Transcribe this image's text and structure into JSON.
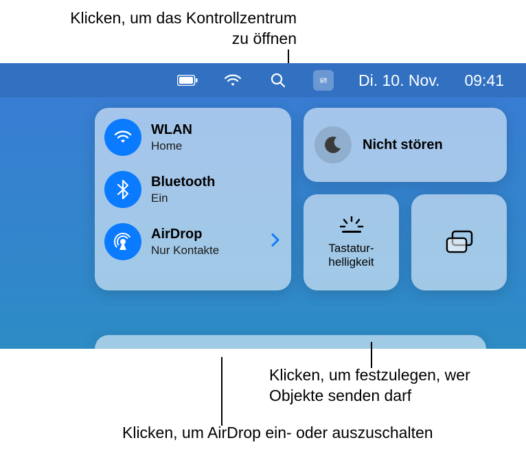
{
  "callouts": {
    "top": "Klicken, um das Kontrollzentrum zu öffnen",
    "right": "Klicken, um festzulegen, wer Objekte senden darf",
    "bottom": "Klicken, um AirDrop ein- oder auszuschalten"
  },
  "menubar": {
    "date": "Di. 10. Nov.",
    "time": "09:41"
  },
  "controlCenter": {
    "wifi": {
      "title": "WLAN",
      "subtitle": "Home"
    },
    "bluetooth": {
      "title": "Bluetooth",
      "subtitle": "Ein"
    },
    "airdrop": {
      "title": "AirDrop",
      "subtitle": "Nur Kontakte"
    },
    "dnd": {
      "title": "Nicht stören"
    },
    "keyboard": {
      "label": "Tastatur-helligkeit"
    }
  }
}
